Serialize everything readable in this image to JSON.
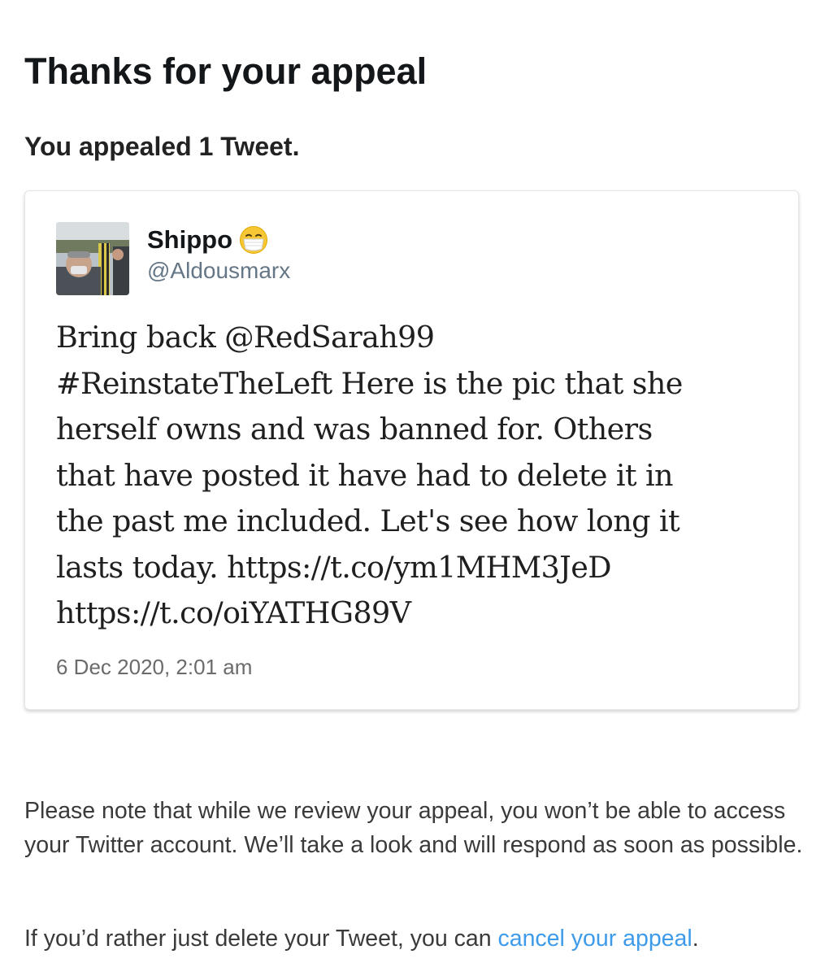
{
  "page": {
    "title": "Thanks for your appeal",
    "subtitle": "You appealed 1 Tweet."
  },
  "tweet": {
    "author_name": "Shippo",
    "author_emoji_icon": "face-with-medical-mask-icon",
    "author_handle": "@Aldousmarx",
    "text_lines": [
      "Bring back @RedSarah99",
      "#ReinstateTheLeft Here is the pic that she",
      "herself owns and was banned for. Others",
      "that have posted it have had to delete it in",
      "the past me included. Let's see how long it",
      "lasts today. https://t.co/ym1MHM3JeD",
      "https://t.co/oiYATHG89V"
    ],
    "timestamp": "6 Dec 2020, 2:01 am"
  },
  "notice": {
    "review_text": "Please note that while we review your appeal, you won’t be able to access your Twitter account. We’ll take a look and will respond as soon as possible.",
    "cancel_prefix": "If you’d rather just delete your Tweet, you can ",
    "cancel_link_label": "cancel your appeal",
    "cancel_suffix": "."
  },
  "colors": {
    "link": "#3d9be9",
    "handle": "#657786",
    "emoji_face": "#f7c634",
    "mask": "#ffffff"
  }
}
